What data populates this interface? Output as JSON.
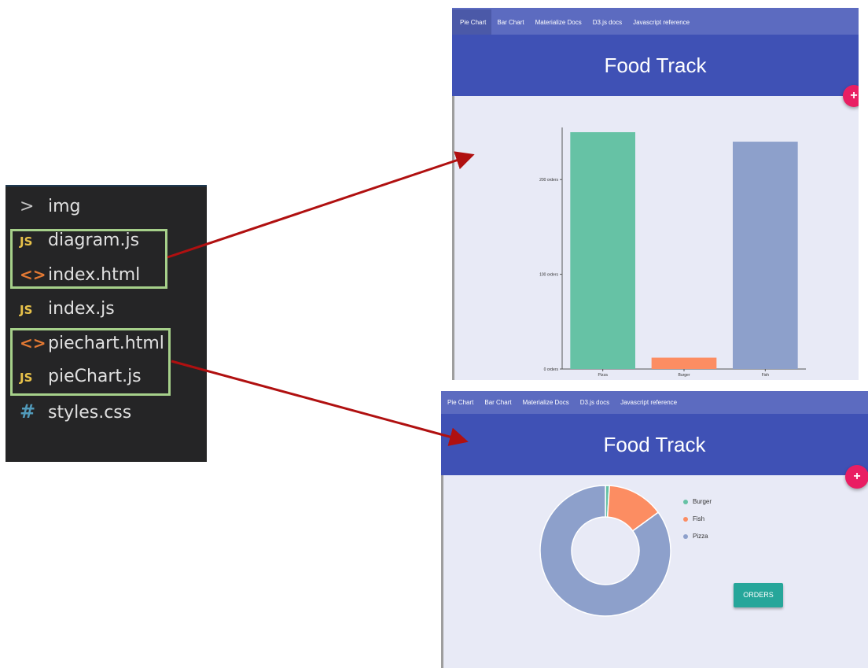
{
  "explorer": {
    "items": [
      {
        "label": "img",
        "icon": "chevron-right-icon",
        "badge": ">"
      },
      {
        "label": "diagram.js",
        "icon": "javascript-file-icon",
        "badge": "JS"
      },
      {
        "label": "index.html",
        "icon": "html-file-icon",
        "badge": "<>"
      },
      {
        "label": "index.js",
        "icon": "javascript-file-icon",
        "badge": "JS"
      },
      {
        "label": "piechart.html",
        "icon": "html-file-icon",
        "badge": "<>"
      },
      {
        "label": "pieChart.js",
        "icon": "javascript-file-icon",
        "badge": "JS"
      },
      {
        "label": "styles.css",
        "icon": "css-file-icon",
        "badge": "#"
      }
    ]
  },
  "nav": [
    "Pie Chart",
    "Bar Chart",
    "Materialize Docs",
    "D3.js docs",
    "Javascript reference"
  ],
  "app_title": "Food Track",
  "fab_label": "+",
  "orders_button": "ORDERS",
  "colors": {
    "burger": "#fc8d62",
    "fish": "#8da0cb",
    "pizza": "#66c2a5",
    "nav": "#5c6bc0",
    "hero": "#3f51b5",
    "fab": "#e91e63",
    "button": "#26a69a",
    "arrow": "#b01010",
    "highlight": "#a6d08a"
  },
  "chart_data": [
    {
      "type": "bar",
      "categories": [
        "Pizza",
        "Burger",
        "Fish"
      ],
      "values": [
        250,
        12,
        240
      ],
      "ylim": [
        0,
        255
      ],
      "y_ticks": [
        {
          "value": 0,
          "label": "0 orders"
        },
        {
          "value": 100,
          "label": "100 orders"
        },
        {
          "value": 200,
          "label": "200 orders"
        }
      ],
      "colors": [
        "#66c2a5",
        "#fc8d62",
        "#8da0cb"
      ],
      "grid": false
    },
    {
      "type": "pie",
      "donut": true,
      "categories": [
        "Burger",
        "Fish",
        "Pizza"
      ],
      "values": [
        1,
        14,
        85
      ],
      "colors": [
        "#66c2a5",
        "#fc8d62",
        "#8da0cb"
      ],
      "legend": [
        "Burger",
        "Fish",
        "Pizza"
      ],
      "legend_position": "right"
    }
  ]
}
